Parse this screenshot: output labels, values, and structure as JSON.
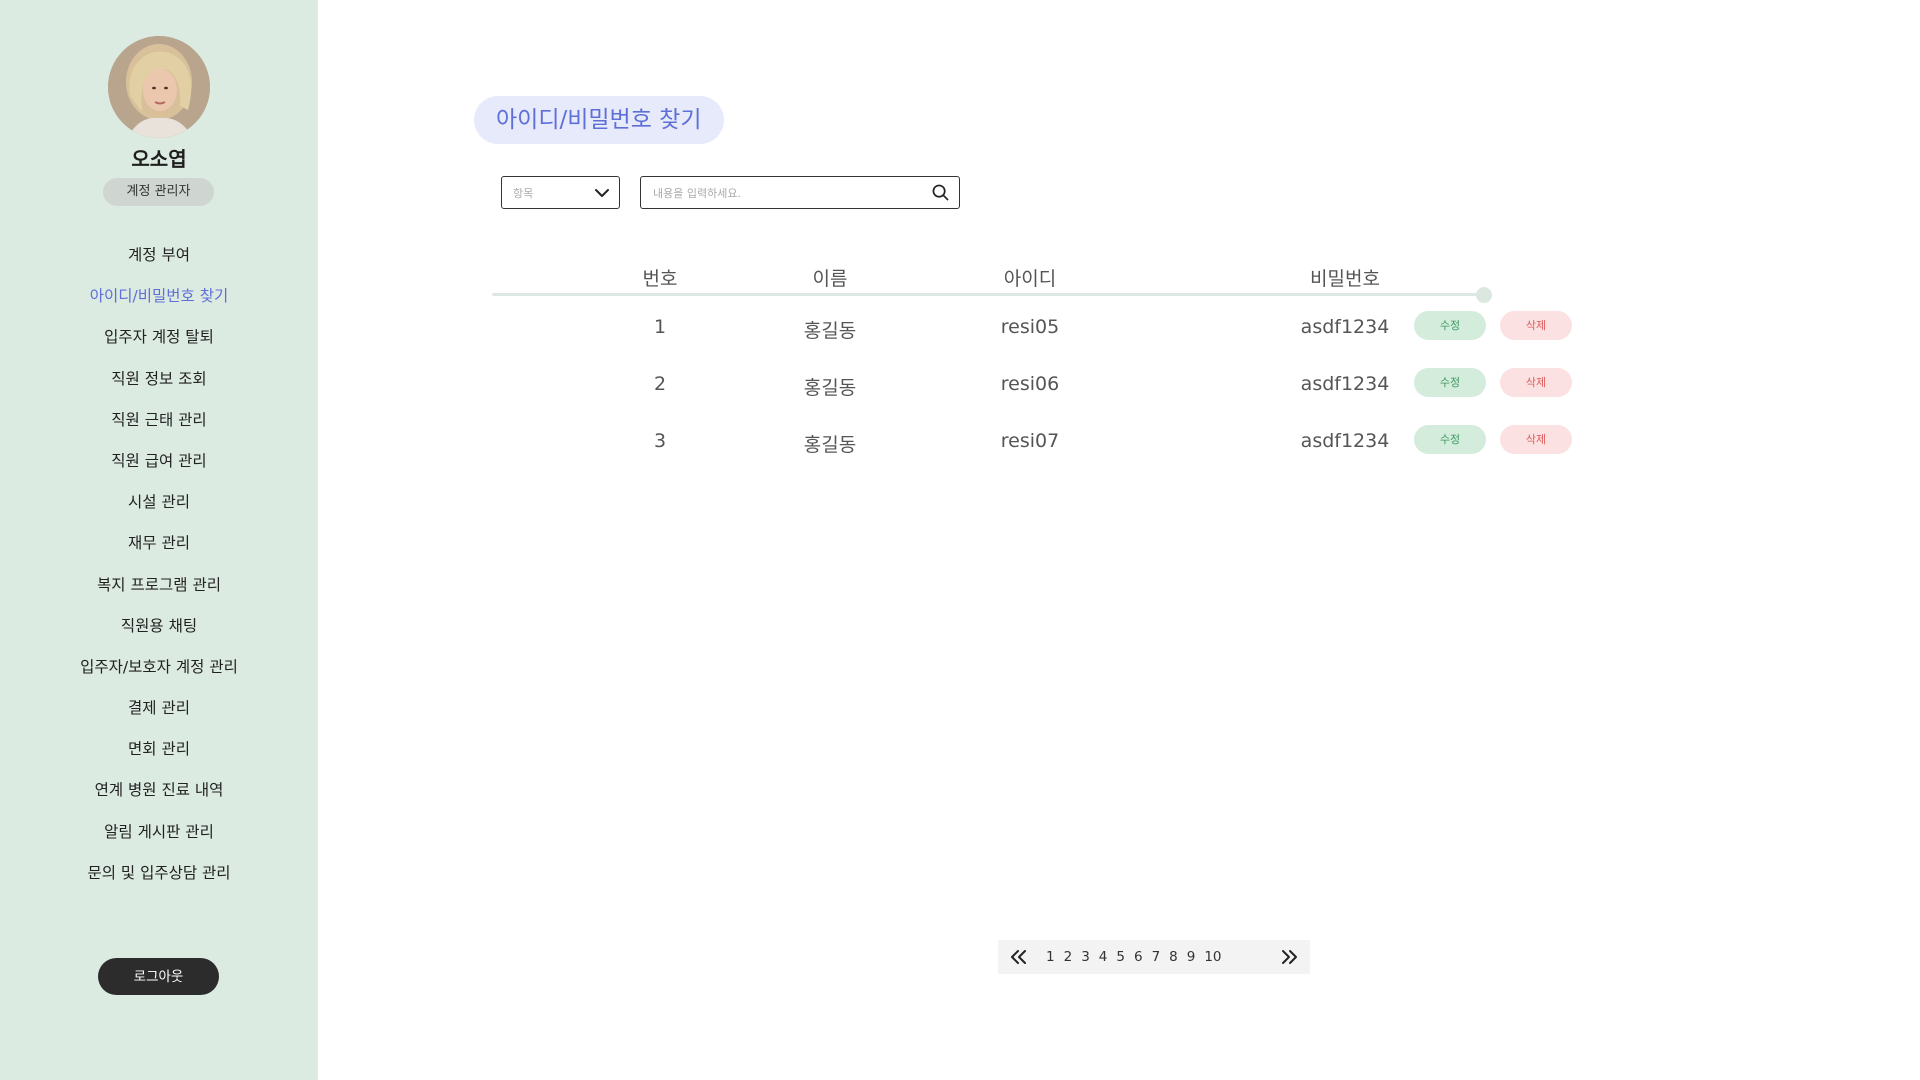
{
  "sidebar": {
    "user_name": "오소엽",
    "role": "계정 관리자",
    "items": [
      {
        "label": "계정 부여"
      },
      {
        "label": "아이디/비밀번호 찾기"
      },
      {
        "label": "입주자 계정 탈퇴"
      },
      {
        "label": "직원 정보 조회"
      },
      {
        "label": "직원 근태 관리"
      },
      {
        "label": "직원 급여 관리"
      },
      {
        "label": "시설 관리"
      },
      {
        "label": "재무 관리"
      },
      {
        "label": "복지 프로그램 관리"
      },
      {
        "label": "직원용 채팅"
      },
      {
        "label": "입주자/보호자 계정 관리"
      },
      {
        "label": "결제 관리"
      },
      {
        "label": "면회 관리"
      },
      {
        "label": "연계 병원 진료 내역"
      },
      {
        "label": "알림 게시판 관리"
      },
      {
        "label": "문의 및 입주상담 관리"
      }
    ],
    "active_item": "아이디/비밀번호 찾기",
    "logout_label": "로그아웃"
  },
  "main": {
    "page_title": "아이디/비밀번호 찾기",
    "filter": {
      "select_value": "항목",
      "search_placeholder": "내용을 입력하세요."
    },
    "table": {
      "headers": [
        "번호",
        "이름",
        "아이디",
        "비밀번호"
      ],
      "rows": [
        {
          "no": "1",
          "name": "홍길동",
          "id": "resi05",
          "password": "asdf1234",
          "edit": "수정",
          "delete": "삭제"
        },
        {
          "no": "2",
          "name": "홍길동",
          "id": "resi06",
          "password": "asdf1234",
          "edit": "수정",
          "delete": "삭제"
        },
        {
          "no": "3",
          "name": "홍길동",
          "id": "resi07",
          "password": "asdf1234",
          "edit": "수정",
          "delete": "삭제"
        }
      ]
    },
    "pagination": {
      "pages": [
        "1",
        "2",
        "3",
        "4",
        "5",
        "6",
        "7",
        "8",
        "9",
        "10"
      ]
    }
  },
  "colors": {
    "sidebar_bg": "#dcebe1",
    "accent": "#5f6fd8",
    "edit_bg": "#d4ecdc",
    "delete_bg": "#fbe1e1"
  }
}
